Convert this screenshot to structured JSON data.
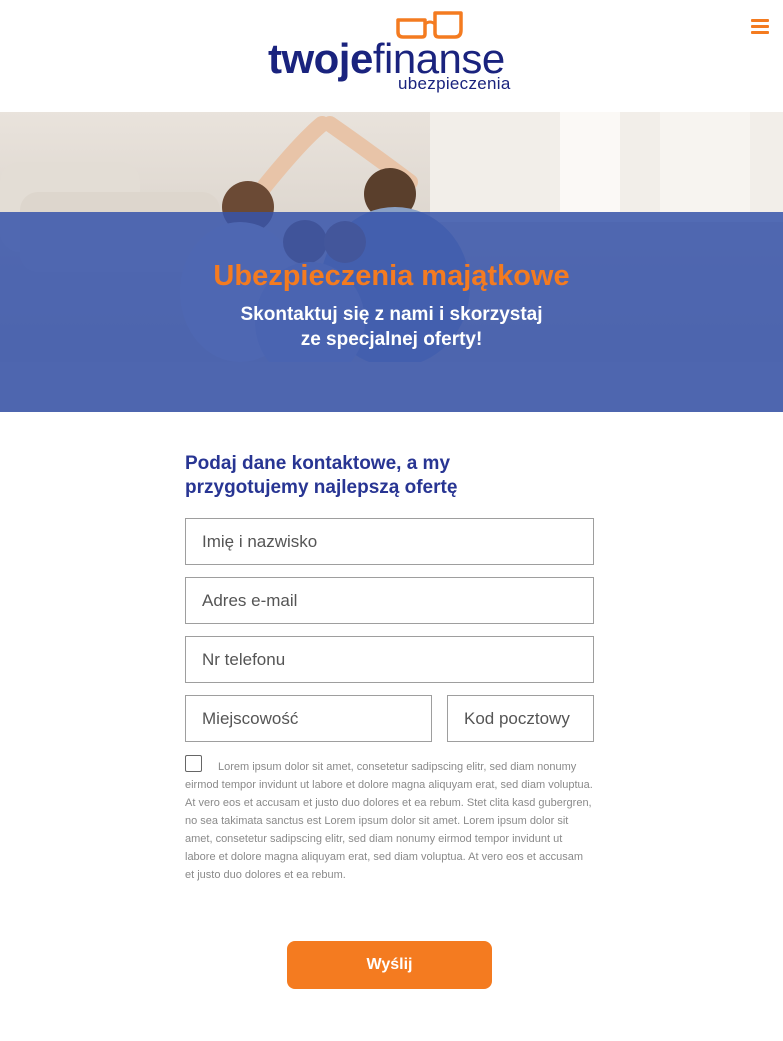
{
  "brand": {
    "logo_bold": "twoje",
    "logo_light": "finanse",
    "logo_sub": "ubezpieczenia",
    "accent_color": "#f47b20",
    "primary_color": "#1a237e"
  },
  "header": {
    "menu_icon": "hamburger-menu-icon"
  },
  "hero": {
    "title": "Ubezpieczenia majątkowe",
    "subtitle_line1": "Skontaktuj się z nami i skorzystaj",
    "subtitle_line2": "ze specjalnej oferty!",
    "overlay_color": "#3653aa"
  },
  "form": {
    "heading_line1": "Podaj dane kontaktowe, a my",
    "heading_line2": "przygotujemy najlepszą ofertę",
    "fields": {
      "name_placeholder": "Imię i nazwisko",
      "email_placeholder": "Adres e-mail",
      "phone_placeholder": "Nr telefonu",
      "city_placeholder": "Miejscowość",
      "zip_placeholder": "Kod pocztowy"
    },
    "consent_checked": false,
    "consent_text": "Lorem ipsum dolor sit amet, consetetur sadipscing elitr, sed diam nonumy eirmod tempor invidunt ut labore et dolore magna aliquyam erat, sed diam voluptua. At vero eos et accusam et justo duo dolores et ea rebum. Stet clita kasd gubergren, no sea takimata sanctus est Lorem ipsum dolor sit amet. Lorem ipsum dolor sit amet, consetetur sadipscing elitr, sed diam nonumy eirmod tempor invidunt ut labore et dolore magna aliquyam erat, sed diam voluptua. At vero eos et accusam et justo duo dolores et ea rebum.",
    "submit_label": "Wyślij"
  }
}
